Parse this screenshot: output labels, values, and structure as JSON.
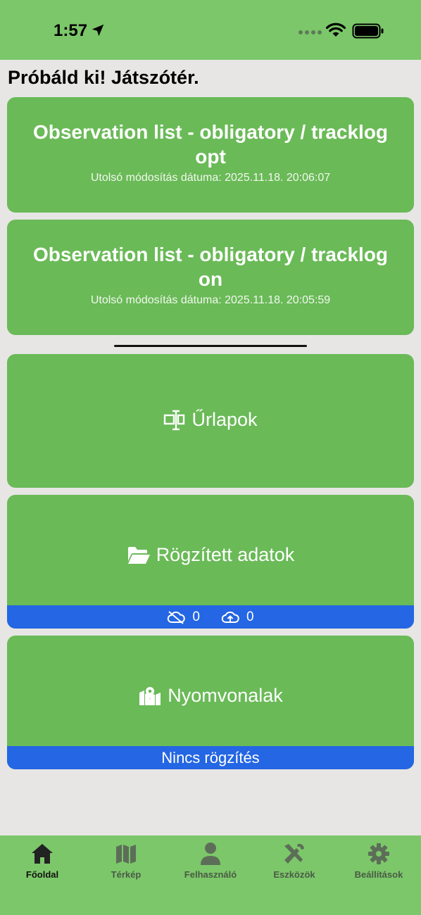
{
  "status_bar": {
    "time": "1:57",
    "icons": [
      "location-arrow-icon",
      "signal-dots-icon",
      "wifi-icon",
      "battery-icon"
    ]
  },
  "page": {
    "title": "Próbáld ki! Játszótér."
  },
  "observation_lists": [
    {
      "title": "Observation list - obligatory / tracklog opt",
      "date": "Utolsó módosítás dátuma: 2025.11.18. 20:06:07"
    },
    {
      "title": "Observation list - obligatory / tracklog on",
      "date": "Utolsó módosítás dátuma: 2025.11.18. 20:05:59"
    }
  ],
  "forms_card": {
    "label": "Űrlapok",
    "icon": "form-icon"
  },
  "recorded_card": {
    "label": "Rögzített adatok",
    "icon": "folder-open-icon",
    "not_synced_count": "0",
    "not_synced_icon": "cloud-off-icon",
    "upload_count": "0",
    "upload_icon": "cloud-upload-icon"
  },
  "tracks_card": {
    "label": "Nyomvonalak",
    "icon": "map-pin-icon",
    "status": "Nincs rögzítés"
  },
  "tab_bar": {
    "tabs": [
      {
        "label": "Főoldal",
        "icon": "home-icon",
        "active": true
      },
      {
        "label": "Térkép",
        "icon": "map-icon",
        "active": false
      },
      {
        "label": "Felhasználó",
        "icon": "user-icon",
        "active": false
      },
      {
        "label": "Eszközök",
        "icon": "tools-icon",
        "active": false
      },
      {
        "label": "Beállítások",
        "icon": "gear-icon",
        "active": false
      }
    ]
  },
  "colors": {
    "card_green": "#6aba57",
    "bar_green": "#7cc76a",
    "strip_blue": "#2466e3",
    "background": "#e7e6e5"
  }
}
